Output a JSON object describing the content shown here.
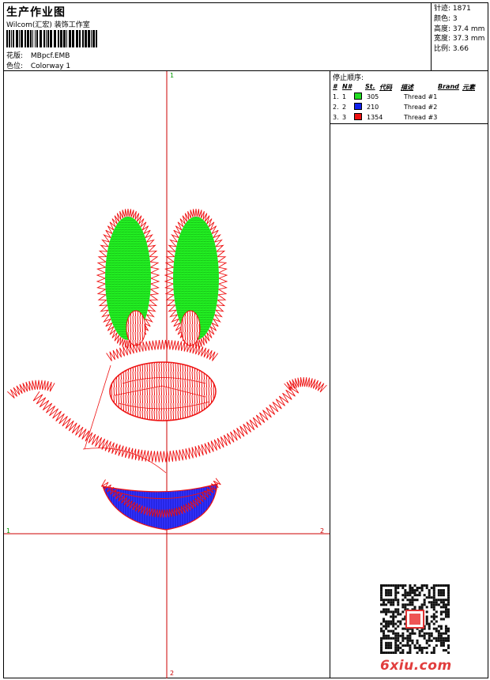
{
  "header": {
    "title": "生产作业图",
    "company": "Wilcom(汇宏) 装饰工作室",
    "design_label": "花版:",
    "design_value": "MBpcf.EMB",
    "color_label": "色位:",
    "color_value": "Colorway 1"
  },
  "specs": [
    {
      "label": "针迹:",
      "value": "1871"
    },
    {
      "label": "颜色:",
      "value": "3"
    },
    {
      "label": "高度:",
      "value": "37.4 mm"
    },
    {
      "label": "宽度:",
      "value": "37.3 mm"
    },
    {
      "label": "比例:",
      "value": "3.66"
    }
  ],
  "axes": {
    "top": "1",
    "left": "1",
    "right": "2",
    "bottom": "2"
  },
  "stops": {
    "title": "停止顺序:",
    "headers": {
      "num": "#",
      "n": "N#",
      "st": "St.",
      "code": "代码",
      "desc": "描述",
      "brand": "Brand",
      "element": "元素"
    },
    "rows": [
      {
        "num": "1.",
        "n": "1",
        "color": "#22dd22",
        "st": "305",
        "desc": "Thread #1"
      },
      {
        "num": "2.",
        "n": "2",
        "color": "#1122ee",
        "st": "210",
        "desc": "Thread #2"
      },
      {
        "num": "3.",
        "n": "3",
        "color": "#ee1111",
        "st": "1354",
        "desc": "Thread #3"
      }
    ]
  },
  "colors": {
    "green": "#22ee22",
    "blue": "#1f1fee",
    "red": "#ee1111",
    "axis": "#cc0000"
  },
  "watermark": "6xiu.com"
}
